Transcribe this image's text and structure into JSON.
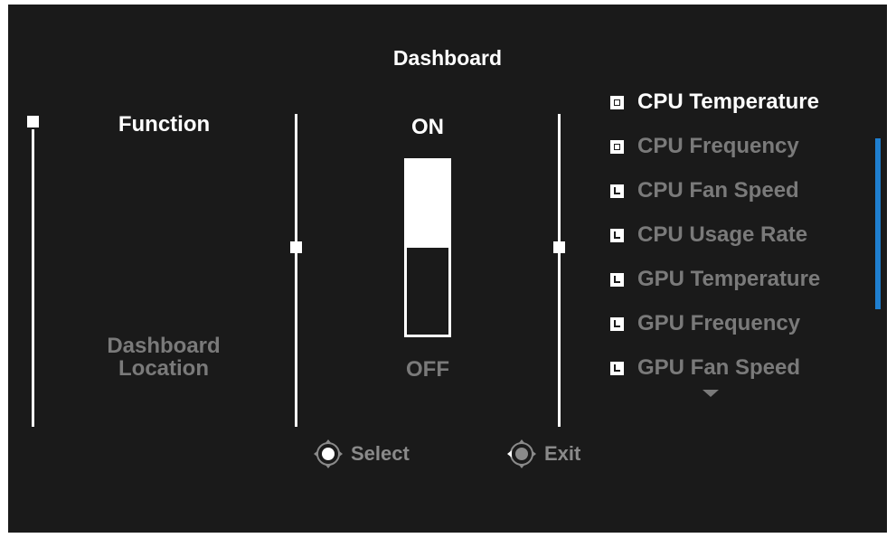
{
  "title": "Dashboard",
  "columns": {
    "function": {
      "label": "Function",
      "sub_label": "Dashboard Location"
    },
    "switch": {
      "on_label": "ON",
      "off_label": "OFF",
      "level": 0.5
    }
  },
  "options": [
    {
      "label": "CPU Temperature",
      "checked": true,
      "highlighted": true
    },
    {
      "label": "CPU Frequency",
      "checked": true,
      "highlighted": false
    },
    {
      "label": "CPU Fan Speed",
      "checked": false,
      "highlighted": false
    },
    {
      "label": "CPU Usage Rate",
      "checked": false,
      "highlighted": false
    },
    {
      "label": "GPU Temperature",
      "checked": false,
      "highlighted": false
    },
    {
      "label": "GPU Frequency",
      "checked": false,
      "highlighted": false
    },
    {
      "label": "GPU Fan Speed",
      "checked": false,
      "highlighted": false
    }
  ],
  "hints": {
    "select": "Select",
    "exit": "Exit"
  },
  "icons": {
    "more": "chevron-down-icon",
    "nav": "joystick-icon"
  },
  "colors": {
    "background": "#1a1a1a",
    "accent": "#1f7fd0",
    "text": "#ffffff",
    "muted": "#7a7a7a"
  }
}
